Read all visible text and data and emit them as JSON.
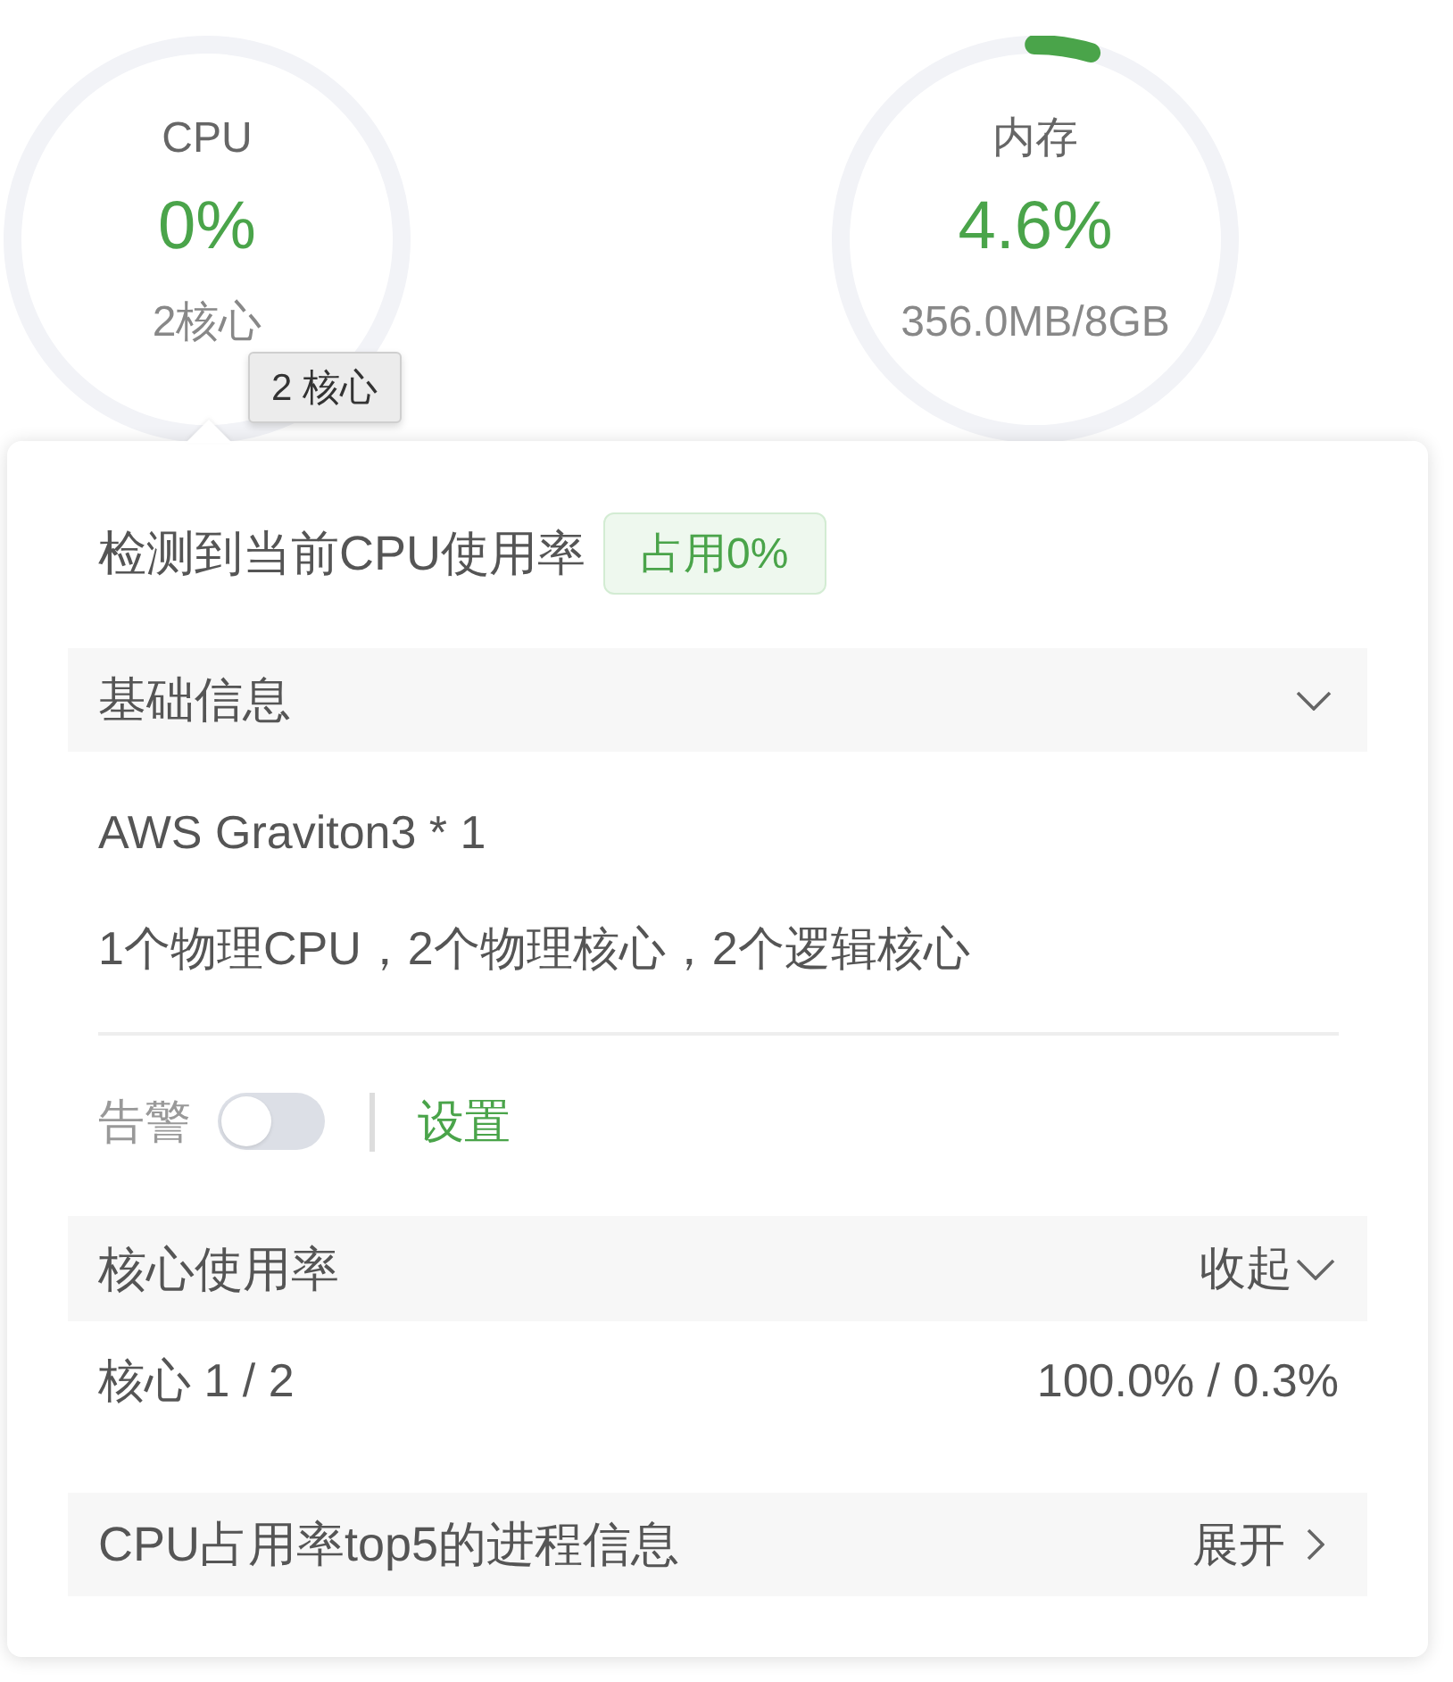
{
  "gauges": [
    {
      "label": "CPU",
      "value": "0%",
      "detail": "2核心",
      "level": 0
    },
    {
      "label": "内存",
      "value": "4.6%",
      "detail": "356.0MB/8GB",
      "level": 0.046
    }
  ],
  "tooltip": {
    "text": "2 核心"
  },
  "popover": {
    "title": "检测到当前CPU使用率",
    "badge": "占用0%",
    "basic_info": {
      "title": "基础信息",
      "expanded": true,
      "lines": [
        "AWS Graviton3 * 1",
        "1个物理CPU，2个物理核心，2个逻辑核心"
      ]
    },
    "alert": {
      "label": "告警",
      "on": false,
      "link": "设置"
    },
    "core_usage": {
      "title": "核心使用率",
      "toggle": "收起",
      "expanded": true,
      "rows": [
        {
          "name": "核心 1 / 2",
          "value": "100.0% / 0.3%"
        }
      ]
    },
    "top_processes": {
      "title": "CPU占用率top5的进程信息",
      "toggle": "展开",
      "expanded": false
    }
  }
}
